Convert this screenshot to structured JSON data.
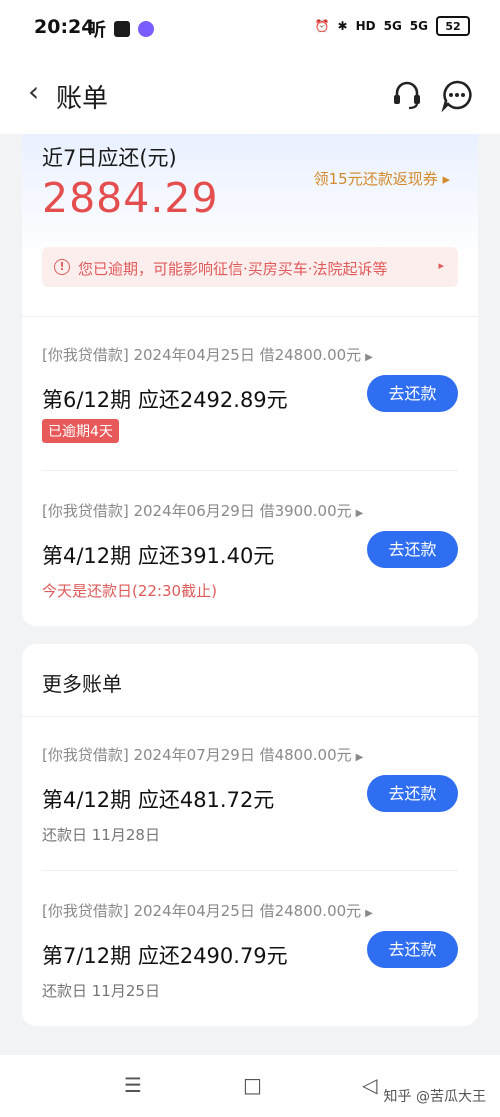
{
  "status_bar": {
    "time": "20:24",
    "glyph": "听",
    "network_1": "HD",
    "network_2": "5G",
    "network_3": "5G",
    "battery": "52"
  },
  "header": {
    "title": "账单",
    "icons": [
      "back-icon",
      "headset-icon",
      "chat-icon"
    ]
  },
  "summary": {
    "title": "近7日应还(元)",
    "amount": "2884.29",
    "cashback_link": "领15元还款返现券 ▸",
    "overdue_notice": "您已逾期，可能影响征信·买房买车·法院起诉等",
    "overdue_icon": "!",
    "overdue_arrow": "▸"
  },
  "due_bills": [
    {
      "meta": "[你我贷借款] 2024年04月25日 借24800.00元",
      "period": "第6/12期 应还2492.89元",
      "tag": "已逾期4天",
      "button": "去还款"
    },
    {
      "meta": "[你我贷借款] 2024年06月29日 借3900.00元",
      "period": "第4/12期 应还391.40元",
      "note": "今天是还款日(22:30截止)",
      "button": "去还款"
    }
  ],
  "more": {
    "title": "更多账单",
    "bills": [
      {
        "meta": "[你我贷借款] 2024年07月29日 借4800.00元",
        "period": "第4/12期 应还481.72元",
        "date": "还款日 11月28日",
        "button": "去还款"
      },
      {
        "meta": "[你我贷借款] 2024年04月25日 借24800.00元",
        "period": "第7/12期 应还2490.79元",
        "date": "还款日 11月25日",
        "button": "去还款"
      }
    ]
  },
  "bottom_nav": {
    "menu": "☰",
    "home": "□",
    "back": "◁"
  },
  "watermark": "知乎 @苦瓜大王",
  "colors": {
    "accent_blue": "#2f6ef1",
    "alert_red": "#e44e4e",
    "promo_orange": "#d28a2c"
  }
}
